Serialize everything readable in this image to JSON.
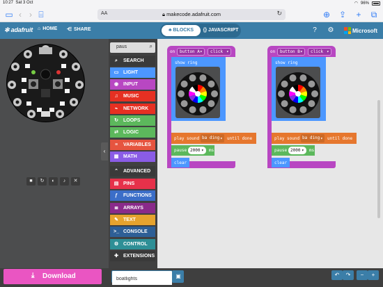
{
  "status_bar": {
    "time": "10:27",
    "date": "Sat 3 Oct",
    "battery": "96%"
  },
  "browser": {
    "text_size_label": "AA",
    "url": "makecode.adafruit.com"
  },
  "header": {
    "brand": "adafruit",
    "home_label": "HOME",
    "share_label": "SHARE",
    "blocks_tab": "BLOCKS",
    "javascript_tab": "JAVASCRIPT",
    "microsoft_label": "Microsoft",
    "microsoft_colors": [
      "#f25022",
      "#7fba00",
      "#00a4ef",
      "#ffb900"
    ]
  },
  "simulator": {
    "controls": [
      "stop-icon",
      "restart-icon",
      "slow-motion-icon",
      "mute-icon",
      "close-icon"
    ]
  },
  "toolbox": {
    "search_value": "paus",
    "categories": [
      {
        "label": "SEARCH",
        "color": "#3a3a3a",
        "icon": "search-icon",
        "glyph": "⌕"
      },
      {
        "label": "LIGHT",
        "color": "#4c97ff",
        "icon": "light-icon",
        "glyph": "▭"
      },
      {
        "label": "INPUT",
        "color": "#b847c2",
        "icon": "input-icon",
        "glyph": "◉"
      },
      {
        "label": "MUSIC",
        "color": "#e63022",
        "icon": "headphones-icon",
        "glyph": "♫"
      },
      {
        "label": "NETWORK",
        "color": "#e63022",
        "icon": "network-icon",
        "glyph": "⌁"
      },
      {
        "label": "LOOPS",
        "color": "#5cb85c",
        "icon": "loops-icon",
        "glyph": "↻"
      },
      {
        "label": "LOGIC",
        "color": "#5cb85c",
        "icon": "logic-icon",
        "glyph": "⇄"
      },
      {
        "label": "VARIABLES",
        "color": "#e6543f",
        "icon": "variables-icon",
        "glyph": "≡"
      },
      {
        "label": "MATH",
        "color": "#8a5ce6",
        "icon": "math-icon",
        "glyph": "▦"
      },
      {
        "label": "ADVANCED",
        "color": "#3a3a3a",
        "icon": "advanced-icon",
        "glyph": "⌃"
      },
      {
        "label": "PINS",
        "color": "#e6314a",
        "icon": "pins-icon",
        "glyph": "▤"
      },
      {
        "label": "FUNCTIONS",
        "color": "#3b6ec8",
        "icon": "functions-icon",
        "glyph": "ƒ"
      },
      {
        "label": "ARRAYS",
        "color": "#8a2a8a",
        "icon": "arrays-icon",
        "glyph": "≣"
      },
      {
        "label": "TEXT",
        "color": "#e6a32e",
        "icon": "text-icon",
        "glyph": "✎"
      },
      {
        "label": "CONSOLE",
        "color": "#2e5f96",
        "icon": "console-icon",
        "glyph": ">_"
      },
      {
        "label": "CONTROL",
        "color": "#2e8f96",
        "icon": "control-icon",
        "glyph": "⚙"
      },
      {
        "label": "EXTENSIONS",
        "color": "#3a3a3a",
        "icon": "extensions-icon",
        "glyph": "✚"
      }
    ]
  },
  "blocks": [
    {
      "event_on": "on",
      "event_button": "button A",
      "event_action": "click",
      "show_ring": "show ring",
      "play_sound": "play sound",
      "sound_name": "ba ding",
      "until_done": "until done",
      "pause": "pause",
      "pause_ms": "2000",
      "ms": "ms",
      "clear": "clear"
    },
    {
      "event_on": "on",
      "event_button": "button B",
      "event_action": "click",
      "show_ring": "show ring",
      "play_sound": "play sound",
      "sound_name": "ba ding",
      "until_done": "until done",
      "pause": "pause",
      "pause_ms": "2000",
      "ms": "ms",
      "clear": "clear"
    }
  ],
  "ring_colors": [
    "#ff0000",
    "#ff7f00",
    "#ffff00",
    "#00ff00",
    "#00ffff",
    "#0000ff",
    "#8a2be2",
    "#ff00ff",
    "#ffffff",
    "#000000"
  ],
  "bottom": {
    "download_label": "Download",
    "project_name": "boatlights"
  }
}
